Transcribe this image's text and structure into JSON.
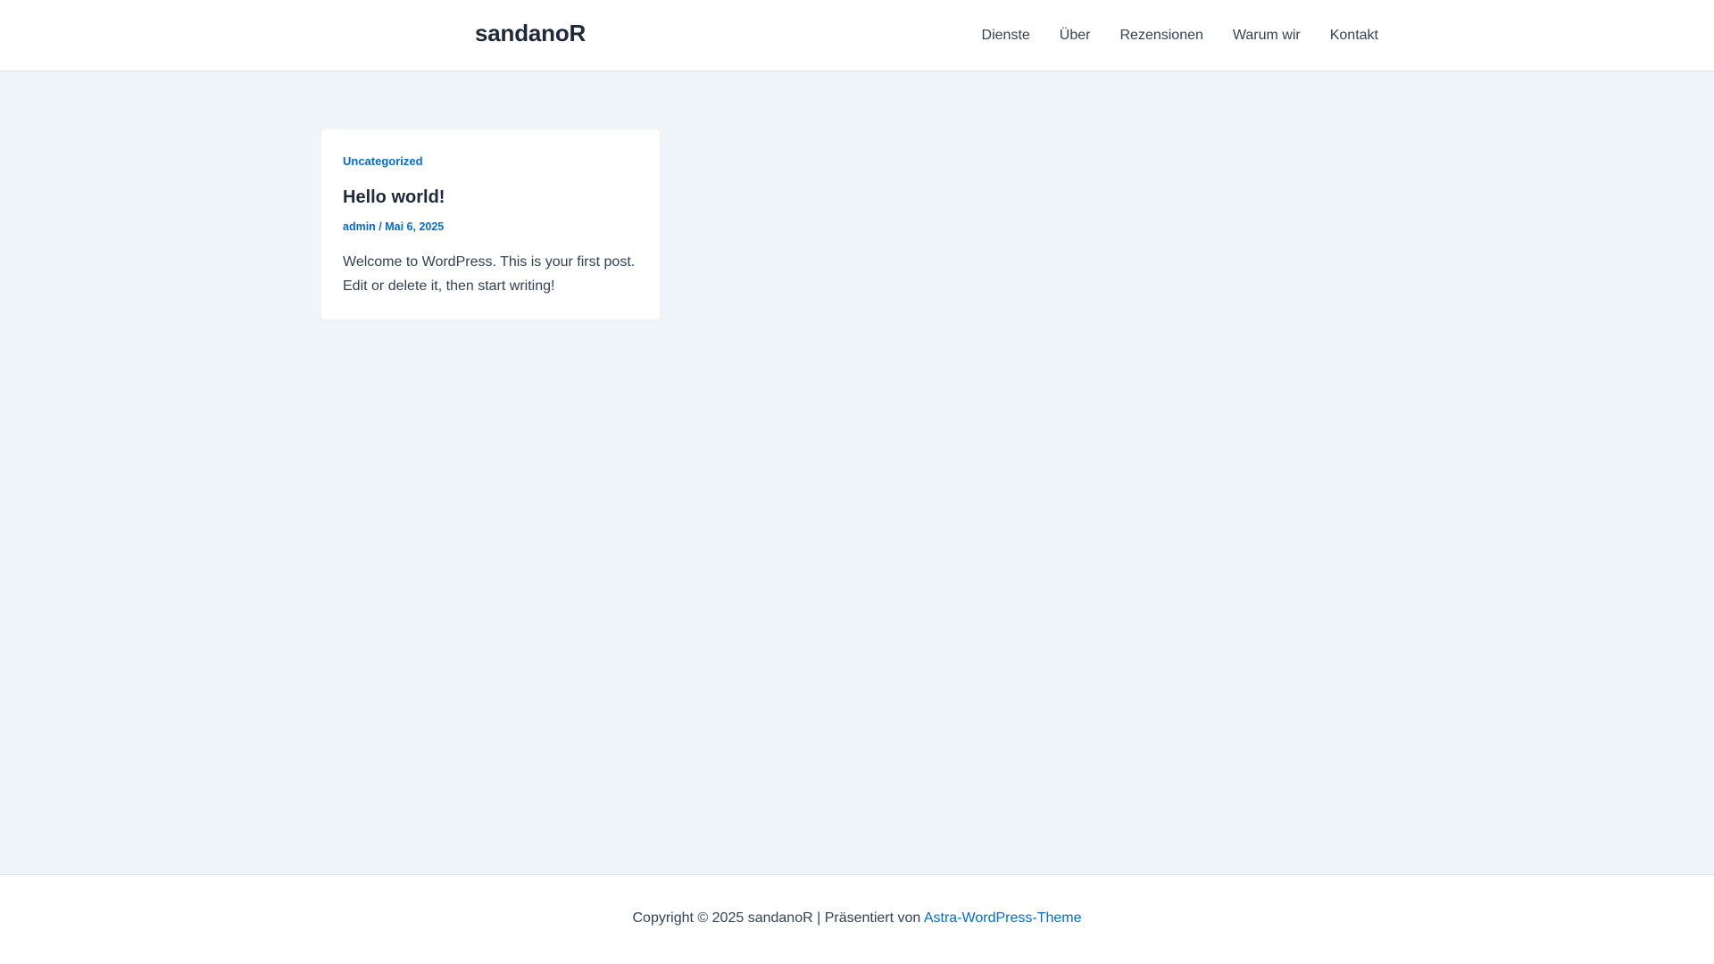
{
  "header": {
    "site_title": "sandanoR",
    "nav": [
      {
        "label": "Dienste"
      },
      {
        "label": "Über"
      },
      {
        "label": "Rezensionen"
      },
      {
        "label": "Warum wir"
      },
      {
        "label": "Kontakt"
      }
    ]
  },
  "post": {
    "category": "Uncategorized",
    "title": "Hello world!",
    "author": "admin",
    "separator": " / ",
    "date": "Mai 6, 2025",
    "excerpt": "Welcome to WordPress. This is your first post. Edit or delete it, then start writing!"
  },
  "footer": {
    "copyright": "Copyright © 2025 sandanoR | Präsentiert von ",
    "theme_link": "Astra-WordPress-Theme"
  },
  "colors": {
    "accent": "#046bd2",
    "heading": "#1e293b",
    "text": "#334155",
    "background": "#f0f5fa"
  }
}
